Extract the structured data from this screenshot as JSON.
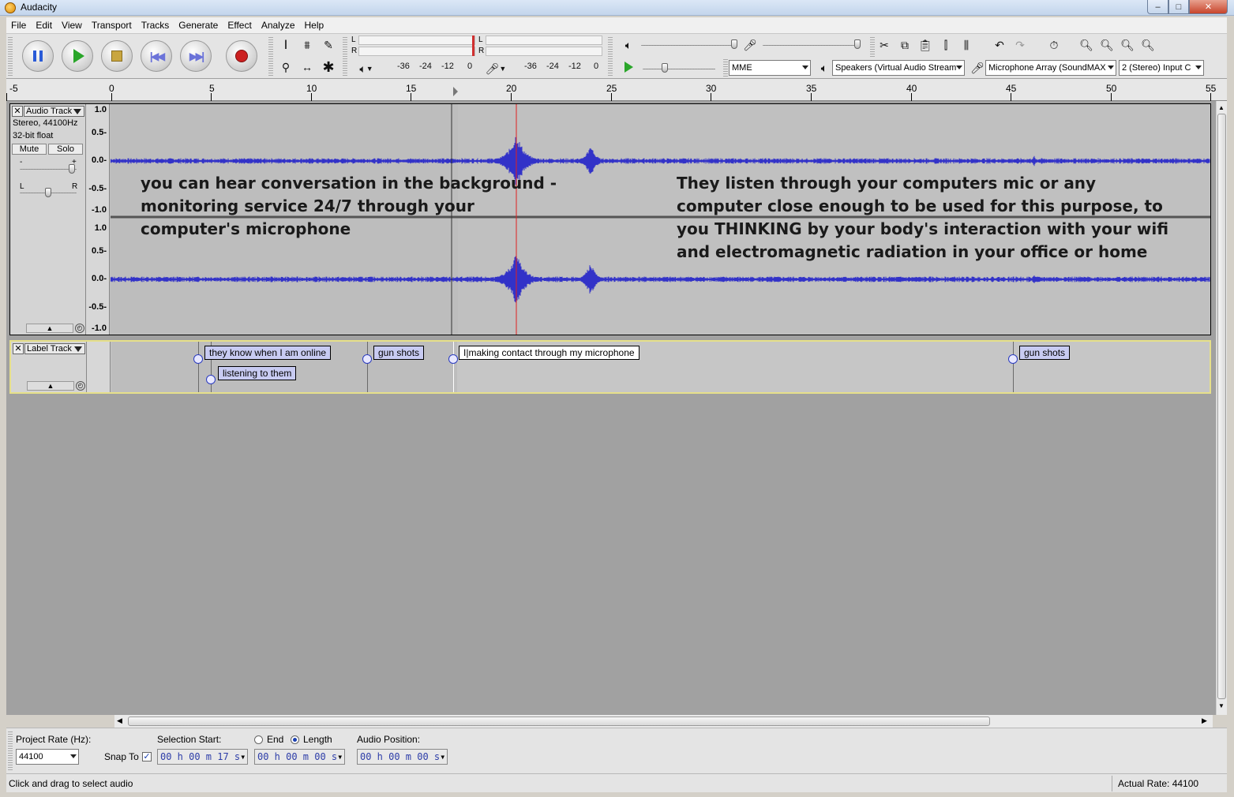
{
  "window": {
    "title": "Audacity",
    "min": "–",
    "max": "□",
    "close": "✕"
  },
  "menu": [
    "File",
    "Edit",
    "View",
    "Transport",
    "Tracks",
    "Generate",
    "Effect",
    "Analyze",
    "Help"
  ],
  "meter": {
    "left_label": "L",
    "right_label": "R",
    "scale": [
      "-36",
      "-24",
      "-12",
      "0"
    ]
  },
  "device": {
    "host": "MME",
    "output": "Speakers (Virtual Audio Stream",
    "input": "Microphone Array (SoundMAX",
    "channels": "2 (Stereo) Input C"
  },
  "ruler": [
    "-5",
    "0",
    "5",
    "10",
    "15",
    "20",
    "25",
    "30",
    "35",
    "40",
    "45",
    "50",
    "55"
  ],
  "audio_track": {
    "name": "Audio Track",
    "info1": "Stereo, 44100Hz",
    "info2": "32-bit float",
    "mute": "Mute",
    "solo": "Solo",
    "gain_minus": "-",
    "gain_plus": "+",
    "pan_left": "L",
    "pan_right": "R",
    "vruler": [
      "1.0",
      "0.5-",
      "0.0-",
      "-0.5-",
      "-1.0"
    ],
    "overlay_left": [
      "you can hear conversation in the background -",
      "monitoring service 24/7 through your",
      "computer's microphone"
    ],
    "overlay_right": [
      "They listen through your computers mic or any",
      "computer close enough to be used for this purpose, to",
      "you THINKING by your body's interaction with your wifi",
      "and electromagnetic radiation in your office or home"
    ]
  },
  "label_track": {
    "name": "Label Track",
    "labels": [
      "they know when I am online",
      "listening to them",
      "gun shots",
      "I|making contact through my microphone",
      "gun shots"
    ]
  },
  "selection": {
    "rate_label": "Project Rate (Hz):",
    "rate_value": "44100",
    "snap_label": "Snap To",
    "snap_check": "✓",
    "start_label": "Selection Start:",
    "end_label": "End",
    "length_label": "Length",
    "position_label": "Audio Position:",
    "start_time": "00 h 00 m 17 s",
    "length_time": "00 h 00 m 00 s",
    "position_time": "00 h 00 m 00 s"
  },
  "status": {
    "hint": "Click and drag to select audio",
    "actual_rate": "Actual Rate: 44100"
  },
  "colors": {
    "waveform": "#3232c8",
    "playhead": "#e02020",
    "label_bg": "#c8cbf2"
  }
}
